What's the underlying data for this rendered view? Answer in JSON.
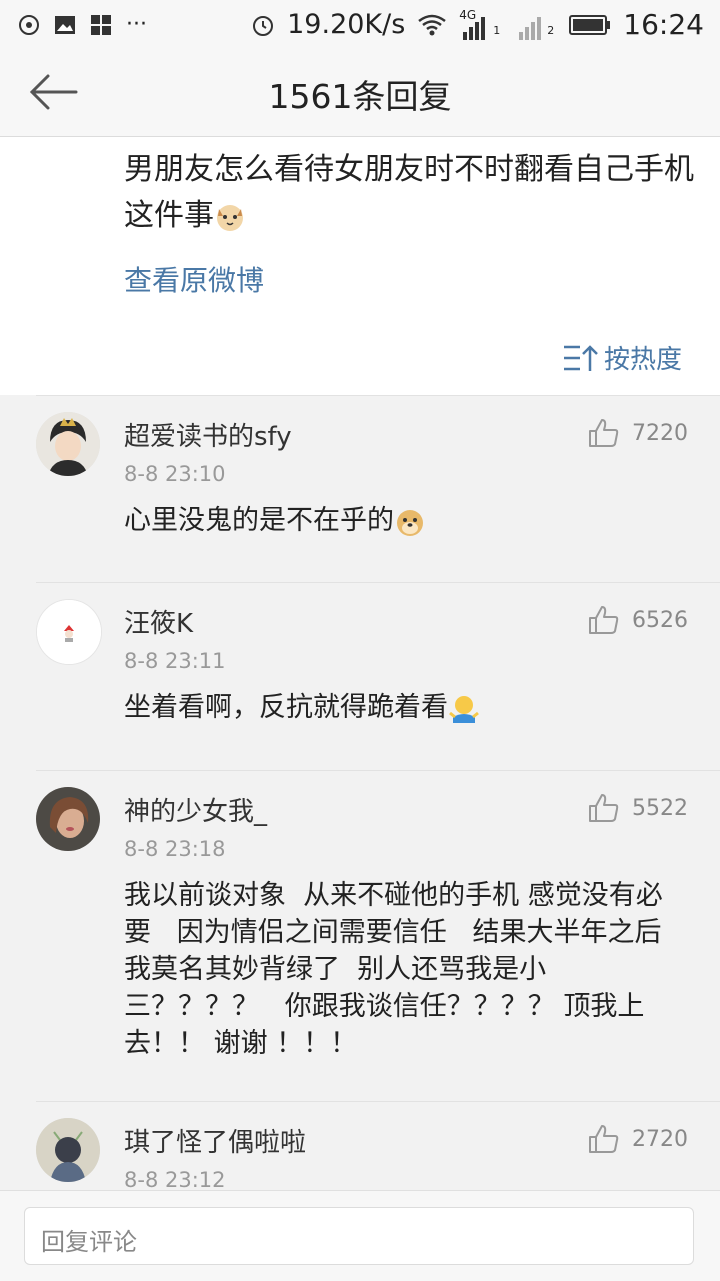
{
  "status_bar": {
    "speed": "19.20K/s",
    "network": "4G",
    "sim1": "1",
    "sim2": "2",
    "time": "16:24"
  },
  "header": {
    "title": "1561条回复"
  },
  "post": {
    "text": "男朋友怎么看待女朋友时不时翻看自己手机这件事",
    "view_original": "查看原微博",
    "sort_label": "按热度"
  },
  "comments": [
    {
      "name": "超爱读书的sfy",
      "time": "8-8 23:10",
      "likes": "7220",
      "text": "心里没鬼的是不在乎的"
    },
    {
      "name": "汪筱K",
      "time": "8-8 23:11",
      "likes": "6526",
      "text": "坐着看啊，反抗就得跪着看"
    },
    {
      "name": "神的少女我_",
      "time": "8-8 23:18",
      "likes": "5522",
      "text": "我以前谈对象  从来不碰他的手机 感觉没有必要   因为情侣之间需要信任   结果大半年之后  我莫名其妙背绿了  别人还骂我是小三？？？？   你跟我谈信任？？？？ 顶我上去！！ 谢谢 ！！！"
    },
    {
      "name": "琪了怪了偶啦啦",
      "time": "8-8 23:12",
      "likes": "2720",
      "text": ""
    }
  ],
  "reply_input": {
    "placeholder": "回复评论"
  },
  "colors": {
    "link": "#4a78a6",
    "background": "#f2f2f2"
  }
}
